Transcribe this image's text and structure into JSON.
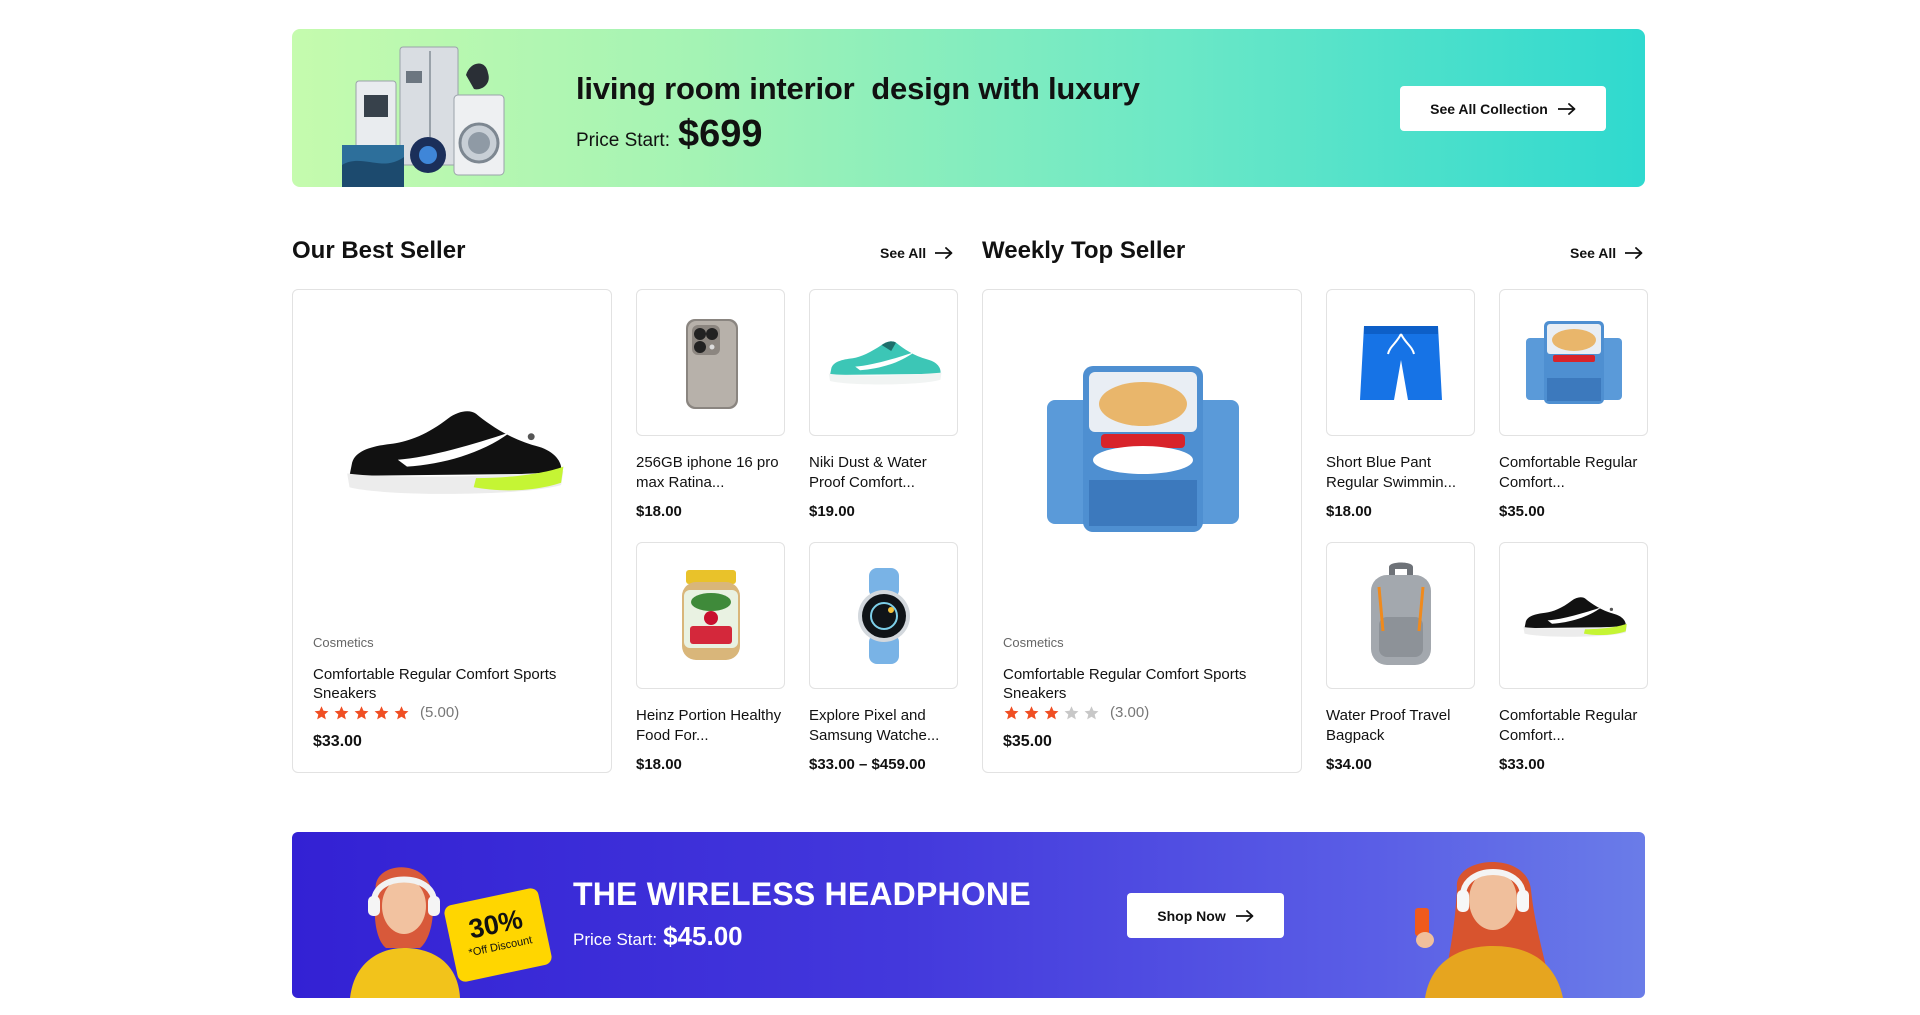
{
  "top_banner": {
    "headline": "living room interior  design with luxury",
    "price_label": "Price Start:",
    "price_value": "$699",
    "button_label": "See All Collection"
  },
  "best_seller": {
    "title": "Our Best Seller",
    "see_all": "See All",
    "featured": {
      "category": "Cosmetics",
      "title": "Comfortable Regular Comfort Sports Sneakers",
      "rating": 5,
      "rating_text": "(5.00)",
      "price": "$33.00"
    },
    "items": [
      {
        "name": "256GB iphone 16 pro max Ratina...",
        "price": "$18.00",
        "icon": "smartphone-icon"
      },
      {
        "name": "Niki Dust & Water Proof Comfort...",
        "price": "$19.00",
        "icon": "sneaker-icon"
      },
      {
        "name": "Heinz Portion Healthy  Food For...",
        "price": "$18.00",
        "icon": "baby-food-jar-icon"
      },
      {
        "name": "Explore Pixel and Samsung Watche...",
        "price": "$33.00 – $459.00",
        "icon": "smartwatch-icon"
      }
    ]
  },
  "weekly_top": {
    "title": "Weekly Top Seller",
    "see_all": "See All",
    "featured": {
      "category": "Cosmetics",
      "title": "Comfortable Regular Comfort Sports Sneakers",
      "rating": 3,
      "rating_text": "(3.00)",
      "price": "$35.00"
    },
    "items": [
      {
        "name": "Short Blue Pant Regular Swimmin...",
        "price": "$18.00",
        "icon": "shorts-icon"
      },
      {
        "name": "Comfortable Regular Comfort...",
        "price": "$35.00",
        "icon": "cheese-pack-icon"
      },
      {
        "name": "Water Proof Travel Bagpack",
        "price": "$34.00",
        "icon": "backpack-icon"
      },
      {
        "name": "Comfortable Regular Comfort...",
        "price": "$33.00",
        "icon": "sneaker-icon"
      }
    ]
  },
  "bottom_banner": {
    "title": "THE WIRELESS HEADPHONE",
    "price_label": "Price Start:",
    "price_value": "$45.00",
    "button_label": "Shop Now",
    "discount_value": "30%",
    "discount_label": "*Off Discount"
  },
  "colors": {
    "star_filled": "#f04e23",
    "star_empty": "#c8c8c8",
    "bottom_banner_start": "#3321d4",
    "bottom_banner_end": "#6a7ce8"
  }
}
